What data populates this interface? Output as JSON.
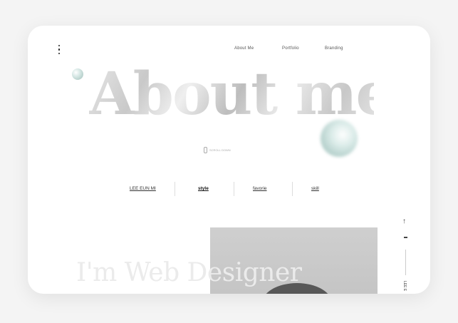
{
  "nav": {
    "items": [
      "About Me",
      "Portfolio",
      "Branding"
    ]
  },
  "hero": {
    "title": "About me",
    "scroll_label": "SCROLL DOWN"
  },
  "tabs": [
    {
      "label": "LEE EUN MI"
    },
    {
      "label": "style"
    },
    {
      "label": "favorie"
    },
    {
      "label": "skill"
    }
  ],
  "section": {
    "heading": "I'm Web Designer"
  },
  "side": {
    "label": "LEE E"
  },
  "colors": {
    "background": "#f4f4f4",
    "card": "#ffffff",
    "accent_orb": "#8fb3ac"
  },
  "icons": {
    "menu": "vertical-dots-icon",
    "top": "arrow-up-icon",
    "scroll": "mouse-icon"
  }
}
